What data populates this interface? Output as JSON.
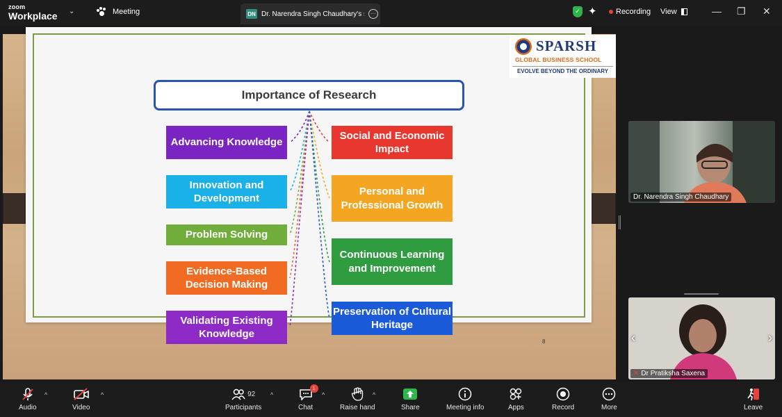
{
  "topbar": {
    "brand_top": "zoom",
    "brand_bottom": "Workplace",
    "meeting_label": "Meeting",
    "share_badge": "DN",
    "share_tab_title": "Dr. Narendra Singh Chaudhary's s",
    "recording_label": "Recording",
    "view_label": "View",
    "icons": [
      "chevron-down-icon",
      "paw-icon",
      "more-icon",
      "shield-icon",
      "sparkle-icon",
      "record-dot-icon",
      "view-icon",
      "minimize-icon",
      "restore-icon",
      "close-icon"
    ]
  },
  "slide": {
    "title": "Importance of Research",
    "logo_name": "SPARSH",
    "logo_subtitle": "GLOBAL BUSINESS SCHOOL",
    "logo_tagline": "EVOLVE BEYOND THE ORDINARY",
    "page_number": "8",
    "left_items": [
      {
        "label": "Advancing Knowledge",
        "color": "#7b24c4"
      },
      {
        "label": "Innovation and Development",
        "color": "#1ab0e8"
      },
      {
        "label": "Problem Solving",
        "color": "#71ad3a"
      },
      {
        "label": "Evidence-Based Decision Making",
        "color": "#f26b23"
      },
      {
        "label": "Validating Existing Knowledge",
        "color": "#8e2ac6"
      }
    ],
    "right_items": [
      {
        "label": "Social and Economic Impact",
        "color": "#e8372f"
      },
      {
        "label": "Personal and Professional Growth",
        "color": "#f4a623"
      },
      {
        "label": "Continuous Learning and Improvement",
        "color": "#2f9d3f"
      },
      {
        "label": "Preservation of Cultural Heritage",
        "color": "#1b5bd9"
      }
    ]
  },
  "participants_panel": {
    "tiles": [
      {
        "name": "Dr. Narendra Singh Chaudhary"
      },
      {
        "name": "Dr Pratiksha Saxena",
        "muted": true
      }
    ]
  },
  "toolbar": {
    "audio": "Audio",
    "video": "Video",
    "participants": "Participants",
    "participants_count": "92",
    "chat": "Chat",
    "chat_badge": "1",
    "raise_hand": "Raise hand",
    "share": "Share",
    "meeting_info": "Meeting info",
    "apps": "Apps",
    "record": "Record",
    "more": "More",
    "leave": "Leave"
  }
}
